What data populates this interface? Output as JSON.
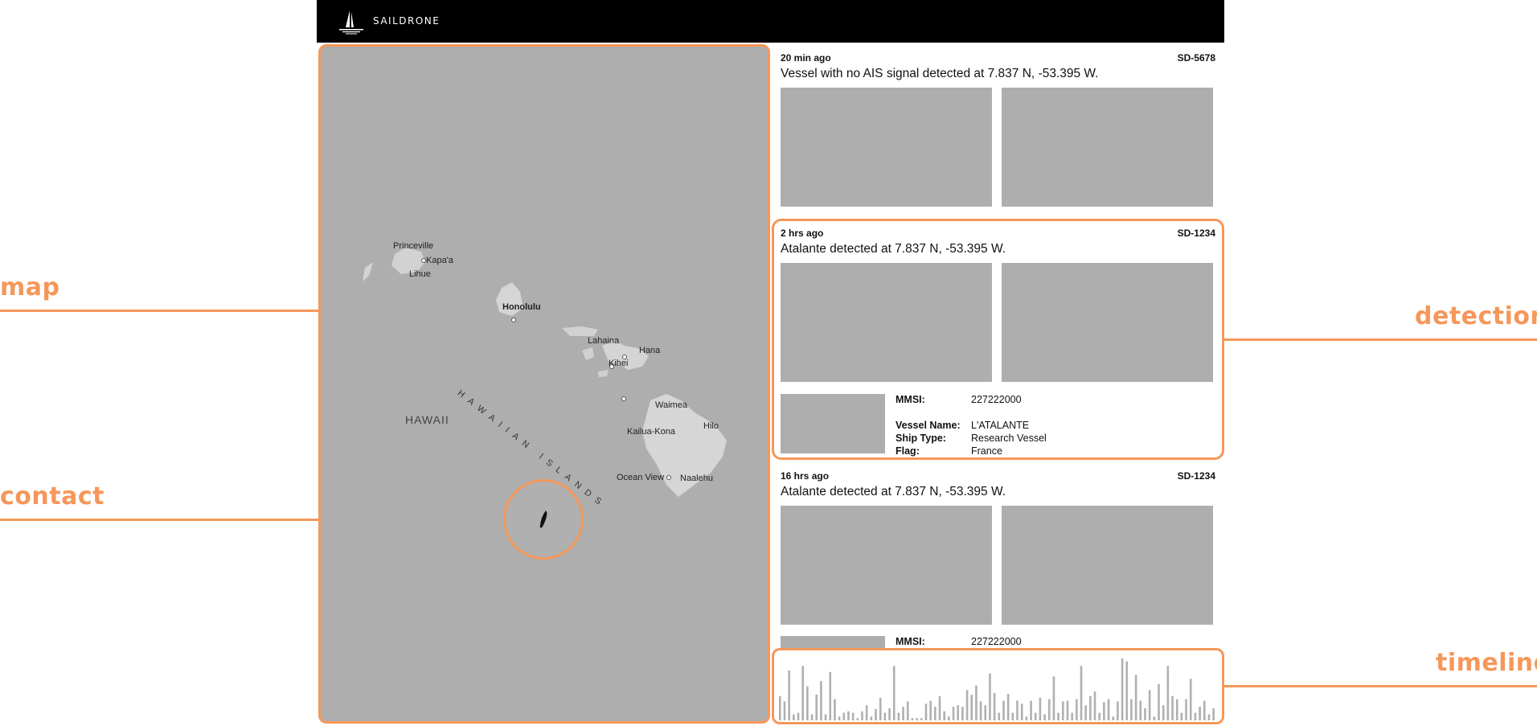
{
  "brand": {
    "name": "SAILDRONE"
  },
  "annotations": {
    "map": "map",
    "contact": "contact",
    "detection": "detection",
    "timeline": "timeline"
  },
  "map": {
    "region_label": "HAWAII",
    "islands_label": "HAWAIIAN ISLANDS",
    "places": {
      "princeville": "Princeville",
      "kapaa": "Kapa'a",
      "lihue": "Lihue",
      "honolulu": "Honolulu",
      "lahaina": "Lahaina",
      "hana": "Hana",
      "kihei": "Kihei",
      "waimea": "Waimea",
      "hilo": "Hilo",
      "kailua_kona": "Kailua-Kona",
      "ocean_view": "Ocean View",
      "naalehu": "Naalehu"
    }
  },
  "feed": [
    {
      "time": "20 min ago",
      "drone_id": "SD-5678",
      "message": "Vessel with no AIS signal detected at 7.837 N, -53.395 W."
    },
    {
      "time": "2 hrs ago",
      "drone_id": "SD-1234",
      "message": "Atalante detected at 7.837 N, -53.395 W.",
      "details": {
        "mmsi_label": "MMSI:",
        "mmsi": "227222000",
        "vessel_name_label": "Vessel Name:",
        "vessel_name": "L'ATALANTE",
        "ship_type_label": "Ship Type:",
        "ship_type": "Research Vessel",
        "flag_label": "Flag:",
        "flag": "France"
      }
    },
    {
      "time": "16 hrs ago",
      "drone_id": "SD-1234",
      "message": "Atalante detected at 7.837 N, -53.395 W.",
      "details": {
        "mmsi_label": "MMSI:",
        "mmsi": "227222000"
      }
    }
  ],
  "timeline": {
    "bar_color": "#b0b0b0",
    "max": 85,
    "values": [
      32,
      25,
      66,
      8,
      10,
      72,
      45,
      8,
      34,
      52,
      8,
      64,
      28,
      5,
      10,
      12,
      10,
      3,
      12,
      20,
      5,
      15,
      30,
      10,
      16,
      72,
      10,
      18,
      25,
      3,
      3,
      3,
      22,
      26,
      18,
      32,
      12,
      5,
      18,
      20,
      18,
      40,
      34,
      46,
      25,
      20,
      62,
      36,
      10,
      26,
      35,
      10,
      26,
      22,
      5,
      26,
      10,
      30,
      8,
      28,
      58,
      10,
      25,
      26,
      10,
      28,
      72,
      20,
      32,
      38,
      10,
      24,
      28,
      5,
      25,
      82,
      78,
      28,
      60,
      26,
      16,
      40,
      5,
      48,
      20,
      72,
      32,
      28,
      10,
      28,
      55,
      10,
      18,
      26,
      8,
      16
    ],
    "colors": {
      "accent": "#f5975a"
    }
  }
}
